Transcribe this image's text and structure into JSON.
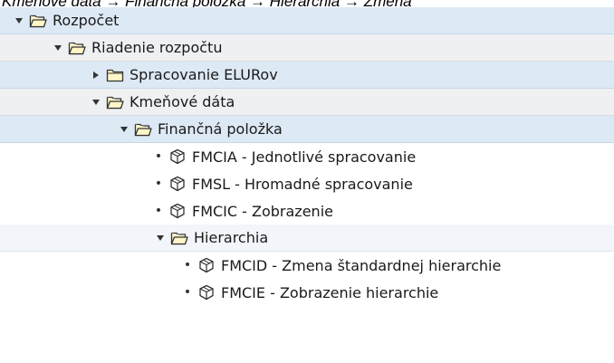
{
  "caption": "Kmeňové dáta → Finančná položka → Hierarchia → Zmena",
  "tree": [
    {
      "label": "Rozpočet",
      "icon": "folder-open-icon",
      "expanded": true
    },
    {
      "label": "Riadenie rozpočtu",
      "icon": "folder-open-icon",
      "expanded": true
    },
    {
      "label": "Spracovanie ELURov",
      "icon": "folder-closed-icon",
      "expanded": false
    },
    {
      "label": "Kmeňové dáta",
      "icon": "folder-open-icon",
      "expanded": true
    },
    {
      "label": "Finančná položka",
      "icon": "folder-open-icon",
      "expanded": true
    },
    {
      "label": "FMCIA - Jednotlivé spracovanie",
      "icon": "transaction-cube-icon"
    },
    {
      "label": "FMSL - Hromadné spracovanie",
      "icon": "transaction-cube-icon"
    },
    {
      "label": "FMCIC - Zobrazenie",
      "icon": "transaction-cube-icon"
    },
    {
      "label": "Hierarchia",
      "icon": "folder-open-icon",
      "expanded": true
    },
    {
      "label": "FMCID - Zmena štandardnej hierarchie",
      "icon": "transaction-cube-icon"
    },
    {
      "label": "FMCIE - Zobrazenie hierarchie",
      "icon": "transaction-cube-icon"
    }
  ],
  "colors": {
    "row_band_blue": "#dde9f5",
    "row_band_gray": "#eef0f2",
    "folder_fill": "#fff6c8",
    "folder_stroke": "#333333"
  }
}
